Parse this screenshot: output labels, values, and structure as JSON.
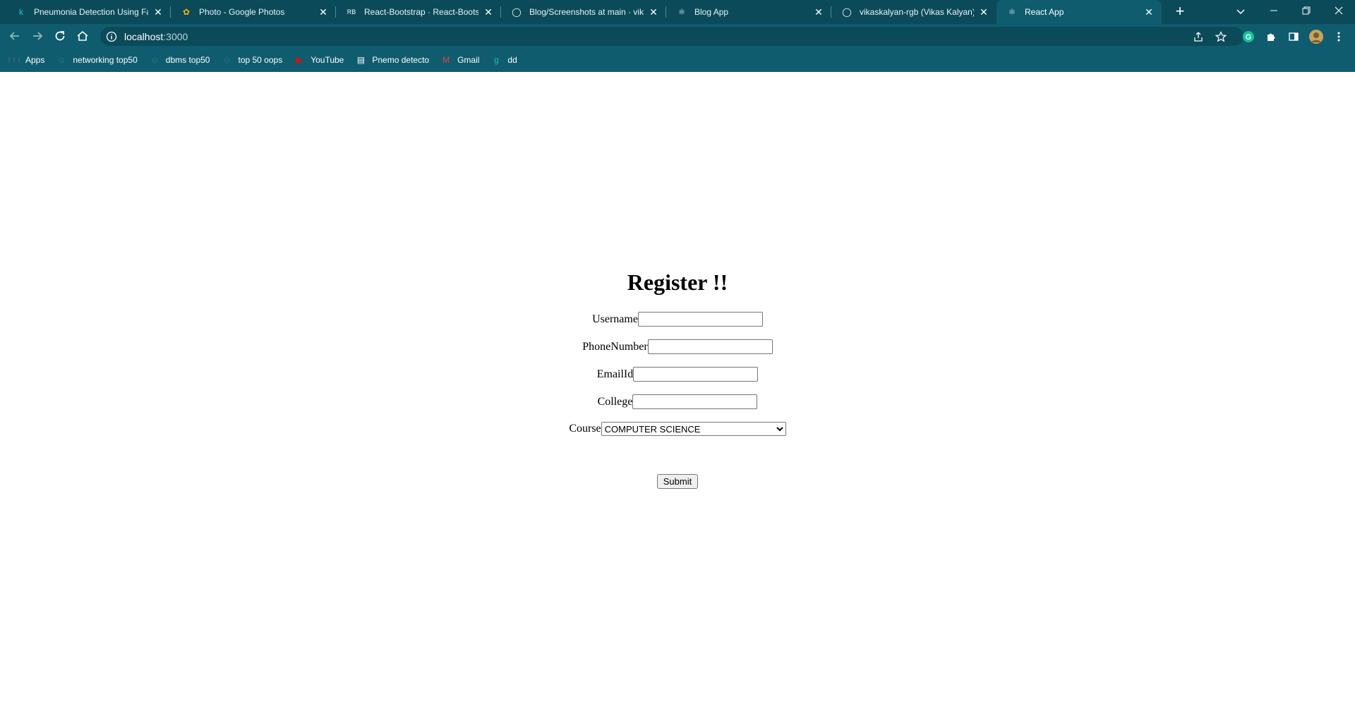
{
  "browser": {
    "tabs": [
      {
        "title": "Pneumonia Detection Using Fast",
        "favicon": "kaggle-k-icon",
        "glyph": "k",
        "glyph_color": "#20beff",
        "active": false
      },
      {
        "title": "Photo - Google Photos",
        "favicon": "google-photos-icon",
        "glyph": "✿",
        "glyph_color": "#f4b400",
        "active": false
      },
      {
        "title": "React-Bootstrap · React-Bootstrap",
        "favicon": "react-bootstrap-icon",
        "glyph": "RB",
        "glyph_color": "#ffffff",
        "active": false
      },
      {
        "title": "Blog/Screenshots at main · vikas",
        "favicon": "github-icon",
        "glyph": "◯",
        "glyph_color": "#ffffff",
        "active": false
      },
      {
        "title": "Blog App",
        "favicon": "react-icon",
        "glyph": "⚛",
        "glyph_color": "#cfe3e8",
        "active": false
      },
      {
        "title": "vikaskalyan-rgb (Vikas Kalyan)",
        "favicon": "github-icon",
        "glyph": "◯",
        "glyph_color": "#ffffff",
        "active": false
      },
      {
        "title": "React App",
        "favicon": "react-icon",
        "glyph": "⚛",
        "glyph_color": "#cfe3e8",
        "active": true
      }
    ],
    "tab_close_glyph": "✕",
    "new_tab_glyph": "+",
    "address": {
      "host": "localhost",
      "port": ":3000"
    },
    "bookmarks": [
      {
        "label": "Apps",
        "icon": "apps-grid-icon",
        "glyph": "⋮⋮⋮",
        "color": "#f28b82"
      },
      {
        "label": "networking top50",
        "icon": "bookmark-page-icon",
        "glyph": "◌",
        "color": "#5f9bd1"
      },
      {
        "label": "dbms top50",
        "icon": "bookmark-page-icon",
        "glyph": "◌",
        "color": "#5f9bd1"
      },
      {
        "label": "top 50 oops",
        "icon": "bookmark-page-icon",
        "glyph": "◌",
        "color": "#5f9bd1"
      },
      {
        "label": "YouTube",
        "icon": "youtube-icon",
        "glyph": "▶",
        "color": "#ff0000"
      },
      {
        "label": "Pnemo detecto",
        "icon": "document-icon",
        "glyph": "▤",
        "color": "#ffffff"
      },
      {
        "label": "Gmail",
        "icon": "gmail-icon",
        "glyph": "M",
        "color": "#ea4335"
      },
      {
        "label": "dd",
        "icon": "grammarly-icon",
        "glyph": "g",
        "color": "#15c39a"
      }
    ],
    "colors": {
      "frame": "#0b4a59",
      "toolbar": "#0f5c6e",
      "grammarly": "#15c39a"
    }
  },
  "form": {
    "title": "Register !!",
    "fields": {
      "username": {
        "label": "Username",
        "value": ""
      },
      "phone": {
        "label": "PhoneNumber",
        "value": ""
      },
      "email": {
        "label": "EmailId",
        "value": ""
      },
      "college": {
        "label": "College",
        "value": ""
      },
      "course": {
        "label": "Course",
        "selected": "COMPUTER SCIENCE"
      }
    },
    "submit_label": "Submit"
  }
}
